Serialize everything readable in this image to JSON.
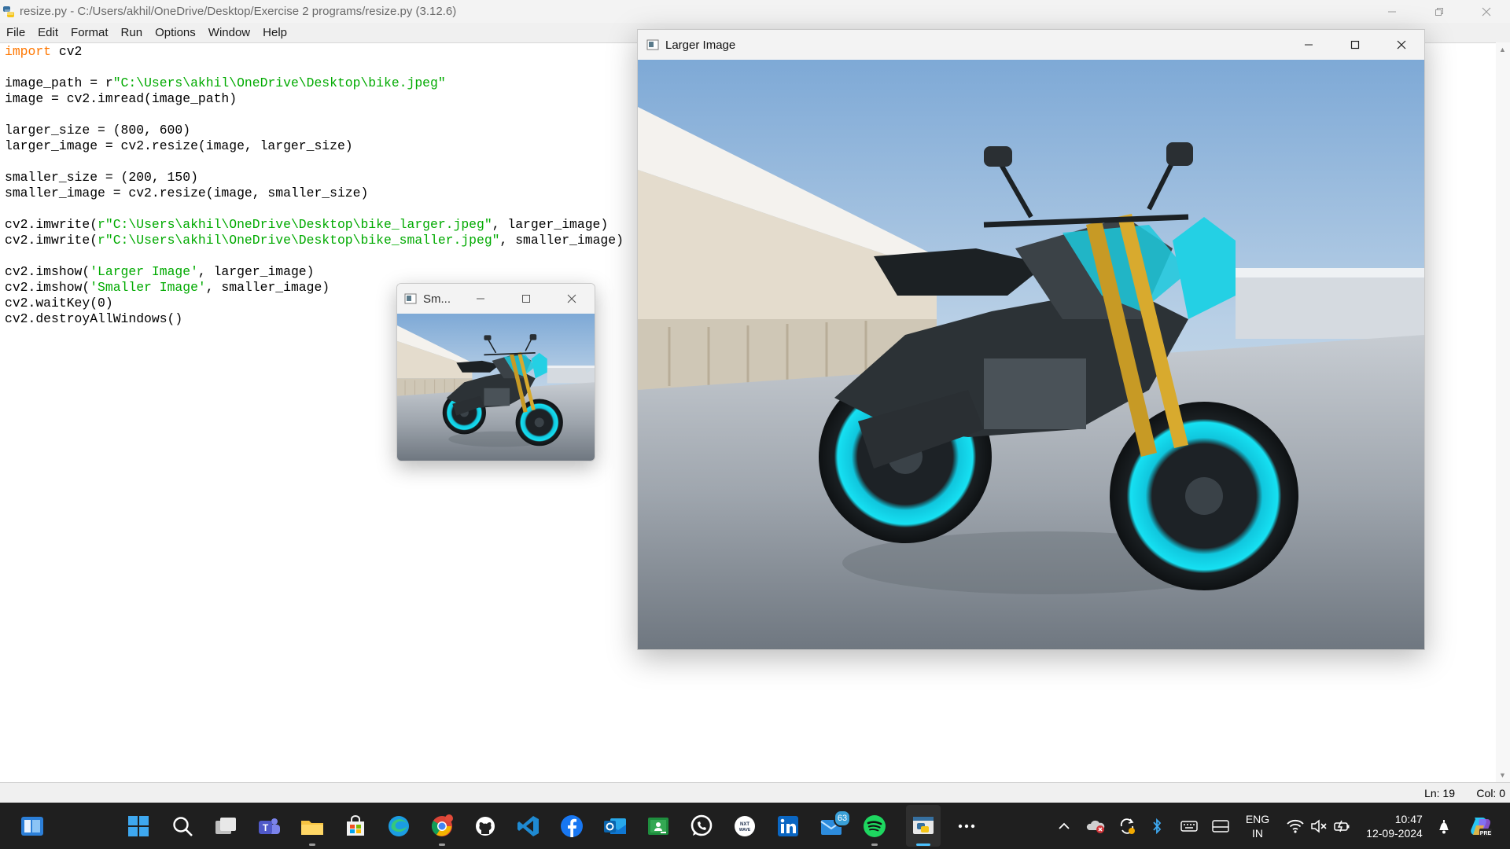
{
  "idle": {
    "title": "resize.py - C:/Users/akhil/OneDrive/Desktop/Exercise 2 programs/resize.py (3.12.6)",
    "menu": [
      "File",
      "Edit",
      "Format",
      "Run",
      "Options",
      "Window",
      "Help"
    ],
    "code_lines": [
      [
        {
          "t": "import",
          "c": "kw"
        },
        {
          "t": " cv2",
          "c": ""
        }
      ],
      [],
      [
        {
          "t": "image_path = r",
          "c": ""
        },
        {
          "t": "\"C:\\Users\\akhil\\OneDrive\\Desktop\\bike.jpeg\"",
          "c": "str"
        }
      ],
      [
        {
          "t": "image = cv2.imread(image_path)",
          "c": ""
        }
      ],
      [],
      [
        {
          "t": "larger_size = (800, 600)",
          "c": ""
        }
      ],
      [
        {
          "t": "larger_image = cv2.resize(image, larger_size)",
          "c": ""
        }
      ],
      [],
      [
        {
          "t": "smaller_size = (200, 150)",
          "c": ""
        }
      ],
      [
        {
          "t": "smaller_image = cv2.resize(image, smaller_size)",
          "c": ""
        }
      ],
      [],
      [
        {
          "t": "cv2.imwrite(",
          "c": ""
        },
        {
          "t": "r\"C:\\Users\\akhil\\OneDrive\\Desktop\\bike_larger.jpeg\"",
          "c": "str"
        },
        {
          "t": ", larger_image)",
          "c": ""
        }
      ],
      [
        {
          "t": "cv2.imwrite(",
          "c": ""
        },
        {
          "t": "r\"C:\\Users\\akhil\\OneDrive\\Desktop\\bike_smaller.jpeg\"",
          "c": "str"
        },
        {
          "t": ", smaller_image)",
          "c": ""
        }
      ],
      [],
      [
        {
          "t": "cv2.imshow(",
          "c": ""
        },
        {
          "t": "'Larger Image'",
          "c": "str"
        },
        {
          "t": ", larger_image)",
          "c": ""
        }
      ],
      [
        {
          "t": "cv2.imshow(",
          "c": ""
        },
        {
          "t": "'Smaller Image'",
          "c": "str"
        },
        {
          "t": ", smaller_image)",
          "c": ""
        }
      ],
      [
        {
          "t": "cv2.waitKey(0)",
          "c": ""
        }
      ],
      [
        {
          "t": "cv2.destroyAllWindows()",
          "c": ""
        }
      ]
    ],
    "status": {
      "ln": "Ln: 19",
      "col": "Col: 0"
    }
  },
  "larger_window": {
    "title": "Larger Image"
  },
  "smaller_window": {
    "title": "Sm..."
  },
  "taskbar": {
    "icons": [
      "start-icon",
      "search-icon",
      "task-view-icon",
      "teams-icon",
      "file-explorer-icon",
      "microsoft-store-icon",
      "edge-icon",
      "chrome-icon",
      "github-icon",
      "vscode-icon",
      "facebook-icon",
      "outlook-icon",
      "google-classroom-icon",
      "whatsapp-icon",
      "nxtwave-icon",
      "linkedin-icon",
      "mail-icon",
      "spotify-icon",
      "python-idle-icon",
      "more-icon"
    ],
    "mail_badge": "63",
    "lang_line1": "ENG",
    "lang_line2": "IN",
    "time": "10:47",
    "date": "12-09-2024"
  },
  "colors": {
    "keyword": "#ff7700",
    "string": "#00aa00",
    "taskbar": "#1f1f1f",
    "accent": "#4cc2ff"
  }
}
